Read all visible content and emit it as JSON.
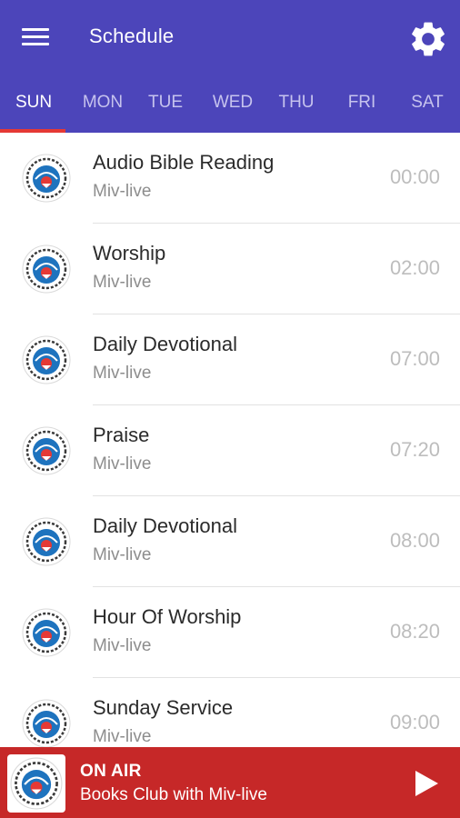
{
  "header": {
    "title": "Schedule",
    "menu_icon": "hamburger-menu-icon",
    "settings_icon": "gear-icon",
    "background": "#4c45ba"
  },
  "tabs": [
    {
      "label": "SUN",
      "active": true
    },
    {
      "label": "MON",
      "active": false
    },
    {
      "label": "TUE",
      "active": false
    },
    {
      "label": "WED",
      "active": false
    },
    {
      "label": "THU",
      "active": false
    },
    {
      "label": "FRI",
      "active": false
    },
    {
      "label": "SAT",
      "active": false
    }
  ],
  "accent_color": "#e53935",
  "schedule": [
    {
      "title": "Audio Bible Reading",
      "host": "Miv-live",
      "time": "00:00"
    },
    {
      "title": "Worship",
      "host": "Miv-live",
      "time": "02:00"
    },
    {
      "title": "Daily Devotional",
      "host": "Miv-live",
      "time": "07:00"
    },
    {
      "title": "Praise",
      "host": "Miv-live",
      "time": "07:20"
    },
    {
      "title": "Daily Devotional",
      "host": "Miv-live",
      "time": "08:00"
    },
    {
      "title": "Hour Of Worship",
      "host": "Miv-live",
      "time": "08:20"
    },
    {
      "title": "Sunday Service",
      "host": "Miv-live",
      "time": "09:00"
    }
  ],
  "player": {
    "status": "ON AIR",
    "now_playing": "Books Club with Miv-live",
    "play_icon": "play-icon",
    "background": "#c62828"
  }
}
